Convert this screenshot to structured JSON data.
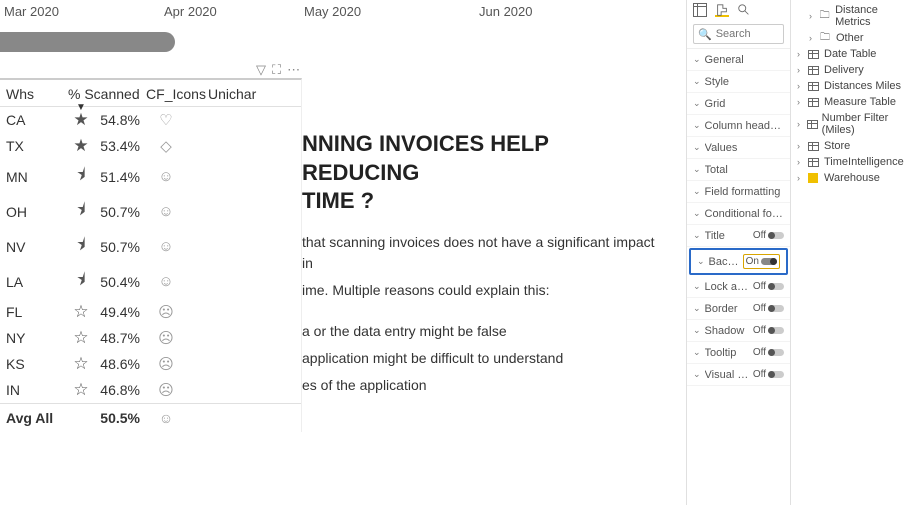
{
  "timeline": [
    "Mar 2020",
    "Apr 2020",
    "May 2020",
    "Jun 2020"
  ],
  "table": {
    "columns": [
      "Whs",
      "% Scanned",
      "CF_Icons",
      "Unichar"
    ],
    "rows": [
      {
        "whs": "CA",
        "star": "★",
        "pct": "54.8%",
        "uni": "♡",
        "uniClass": "yellow-heart"
      },
      {
        "whs": "TX",
        "star": "★",
        "pct": "53.4%",
        "uni": "◇",
        "uniClass": ""
      },
      {
        "whs": "MN",
        "star": "⯨",
        "pct": "51.4%",
        "uni": "☺",
        "uniClass": ""
      },
      {
        "whs": "OH",
        "star": "⯨",
        "pct": "50.7%",
        "uni": "☺",
        "uniClass": ""
      },
      {
        "whs": "NV",
        "star": "⯨",
        "pct": "50.7%",
        "uni": "☺",
        "uniClass": ""
      },
      {
        "whs": "LA",
        "star": "⯨",
        "pct": "50.4%",
        "uni": "☺",
        "uniClass": ""
      },
      {
        "whs": "FL",
        "star": "☆",
        "pct": "49.4%",
        "uni": "☹",
        "uniClass": ""
      },
      {
        "whs": "NY",
        "star": "☆",
        "pct": "48.7%",
        "uni": "☹",
        "uniClass": ""
      },
      {
        "whs": "KS",
        "star": "☆",
        "pct": "48.6%",
        "uni": "☹",
        "uniClass": ""
      },
      {
        "whs": "IN",
        "star": "☆",
        "pct": "46.8%",
        "uni": "☹",
        "uniClass": ""
      }
    ],
    "footer": {
      "label": "Avg All",
      "pct": "50.5%",
      "uni": "☺"
    }
  },
  "textbox": {
    "heading1": "NNING INVOICES HELP REDUCING",
    "heading2": "TIME ?",
    "p1": "that scanning invoices does not have a significant impact in",
    "p2": "ime. Multiple reasons could explain this:",
    "b1": "a or the data entry might be false",
    "b2": "application might be difficult to understand",
    "b3": "es of the application"
  },
  "search": {
    "placeholder": "Search"
  },
  "format_sections": {
    "general": "General",
    "style": "Style",
    "grid": "Grid",
    "column_headers": "Column headers",
    "values": "Values",
    "total": "Total",
    "field_formatting": "Field formatting",
    "conditional_formatting": "Conditional formatting",
    "title": "Title",
    "background": "Backgro...",
    "lock_aspect": "Lock asp...",
    "border": "Border",
    "shadow": "Shadow",
    "tooltip": "Tooltip",
    "visual_header": "Visual he..."
  },
  "toggle": {
    "off": "Off",
    "on": "On"
  },
  "fields": {
    "distance_metrics": "Distance Metrics",
    "other": "Other",
    "date_table": "Date Table",
    "delivery": "Delivery",
    "distances_miles": "Distances Miles",
    "measure_table": "Measure Table",
    "number_filter": "Number Filter (Miles)",
    "store": "Store",
    "timeintelligence": "TimeIntelligence",
    "warehouse": "Warehouse"
  },
  "chart_data": {
    "type": "table",
    "title": "",
    "columns": [
      "Whs",
      "% Scanned"
    ],
    "series": [
      {
        "name": "% Scanned",
        "values": [
          54.8,
          53.4,
          51.4,
          50.7,
          50.7,
          50.4,
          49.4,
          48.7,
          48.6,
          46.8
        ]
      }
    ],
    "categories": [
      "CA",
      "TX",
      "MN",
      "OH",
      "NV",
      "LA",
      "FL",
      "NY",
      "KS",
      "IN"
    ],
    "summary": {
      "label": "Avg All",
      "value": 50.5
    }
  }
}
